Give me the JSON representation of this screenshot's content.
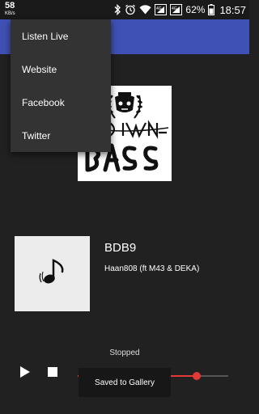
{
  "status_bar": {
    "net_speed": "58",
    "net_speed_unit": "KB/s",
    "battery_percent": "62%",
    "time": "18:57"
  },
  "menu": {
    "items": [
      "Listen Live",
      "Website",
      "Facebook",
      "Twitter"
    ]
  },
  "now_playing": {
    "title": "BDB9",
    "artist": "Haan808 (ft M43 & DEKA)"
  },
  "player": {
    "status": "Stopped",
    "progress": 0.79
  },
  "toast": {
    "message": "Saved to Gallery"
  },
  "colors": {
    "accent": "#3f51b5",
    "seek": "#e53935"
  }
}
